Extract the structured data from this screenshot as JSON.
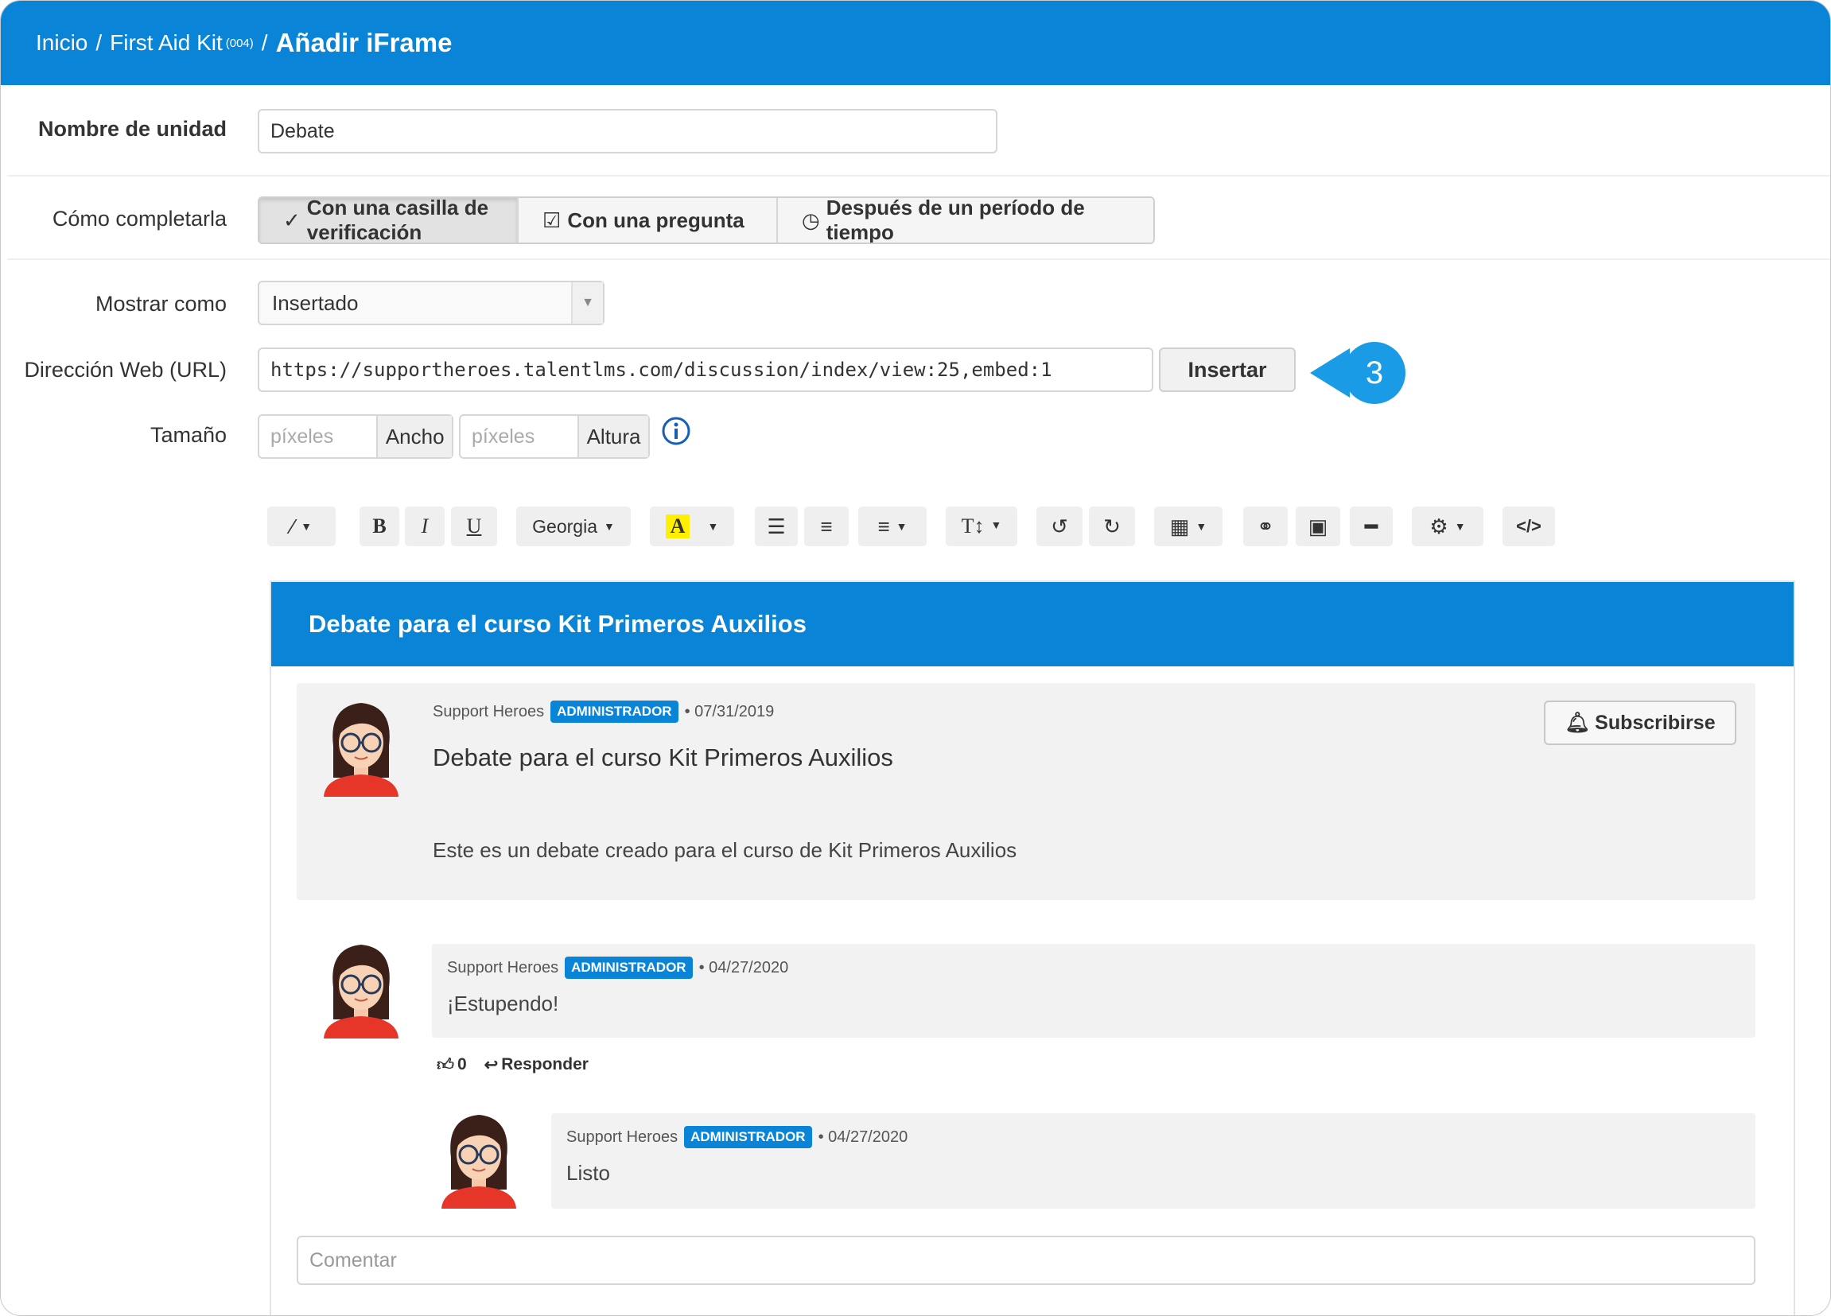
{
  "breadcrumb": {
    "home": "Inicio",
    "course": "First Aid Kit",
    "course_code": "(004)",
    "separator": "/",
    "current": "Añadir iFrame"
  },
  "form": {
    "unit_name_label": "Nombre de unidad",
    "unit_name_value": "Debate",
    "completion_label": "Cómo completarla",
    "completion_options": [
      "Con una casilla de verificación",
      "Con una pregunta",
      "Después de un período de tiempo"
    ],
    "completion_selected": "Con una casilla de verificación",
    "show_as_label": "Mostrar como",
    "show_as_value": "Insertado",
    "url_label": "Dirección Web (URL)",
    "url_value": "https://supportheroes.talentlms.com/discussion/index/view:25,embed:1",
    "insert_button": "Insertar",
    "size_label": "Tamaño",
    "width_placeholder": "píxeles",
    "width_addon": "Ancho",
    "height_placeholder": "píxeles",
    "height_addon": "Altura"
  },
  "callout": {
    "number": "3",
    "color": "#1a9be6"
  },
  "toolbar": {
    "font_name": "Georgia",
    "bold": "B",
    "italic": "I",
    "underline": "U",
    "color_letter": "A",
    "text_size": "T↕"
  },
  "embed": {
    "header": "Debate para el curso Kit Primeros Auxilios",
    "post": {
      "author": "Support Heroes",
      "badge": "ADMINISTRADOR",
      "date": "• 07/31/2019",
      "title": "Debate para el curso Kit Primeros Auxilios",
      "body": "Este es un debate creado para el curso de Kit Primeros Auxilios",
      "subscribe": "Subscribirse"
    },
    "replies": [
      {
        "author": "Support Heroes",
        "badge": "ADMINISTRADOR",
        "date": "• 04/27/2020",
        "text": "¡Estupendo!",
        "likes": "0",
        "reply": "Responder"
      },
      {
        "author": "Support Heroes",
        "badge": "ADMINISTRADOR",
        "date": "• 04/27/2020",
        "text": "Listo"
      }
    ],
    "comment_placeholder": "Comentar"
  },
  "colors": {
    "brand": "#0a84d6",
    "badge": "#0a84d6"
  }
}
